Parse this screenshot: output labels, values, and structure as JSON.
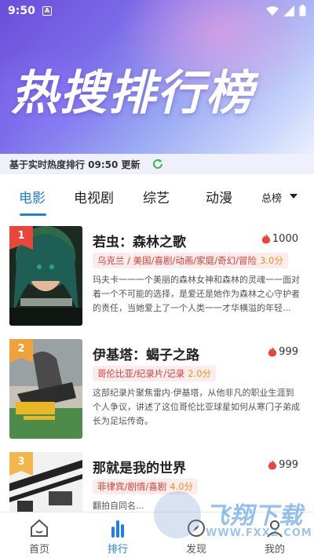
{
  "status": {
    "time": "9:50",
    "a_label": "A"
  },
  "hero": {
    "title": "热搜排行榜"
  },
  "update": {
    "text": "基于实时热度排行 09:50 更新"
  },
  "tabs": [
    {
      "label": "电影"
    },
    {
      "label": "电视剧"
    },
    {
      "label": "综艺"
    },
    {
      "label": "动漫"
    }
  ],
  "total_label": "总榜",
  "items": [
    {
      "rank": "1",
      "title": "若虫：森林之歌",
      "heat": "1000",
      "tags": "乌克兰 / 美国/喜剧/动画/家庭/奇幻/冒险",
      "score": "3.0分",
      "desc": "玛夫卡一一一个美丽的森林女神和森林的灵魂一一面对着一个不可能的选择，是爱还是她作为森林之心守护者的责任，当她爱上了一个人类一一才华横溢的年轻..."
    },
    {
      "rank": "2",
      "title": "伊基塔：蝎子之路",
      "heat": "999",
      "tags": "哥伦比亚/纪录片/记录",
      "score": "2.0分",
      "desc": "这部纪录片聚焦雷内·伊基塔，从他非凡的职业生涯到个人争议，讲述了这位哥伦比亚球星如何从寒门子弟成长为足坛传奇。"
    },
    {
      "rank": "3",
      "title": "那就是我的世界",
      "heat": "999",
      "tags": "菲律宾/剧情/喜剧",
      "score": "4.0分",
      "desc": "翻拍自同名..."
    }
  ],
  "nav": [
    {
      "label": "首页"
    },
    {
      "label": "排行"
    },
    {
      "label": "发现"
    },
    {
      "label": "我的"
    }
  ],
  "watermark": {
    "text": "飞翔下载",
    "url": "WWW.FXXZ.COM"
  },
  "colors": {
    "accent": "#1f7fe6",
    "rank1": "#e8463d",
    "rank2": "#f0a23a",
    "rank3": "#f3b64a",
    "tag_bg": "#fdeceb",
    "tag_text": "#d2403a"
  }
}
